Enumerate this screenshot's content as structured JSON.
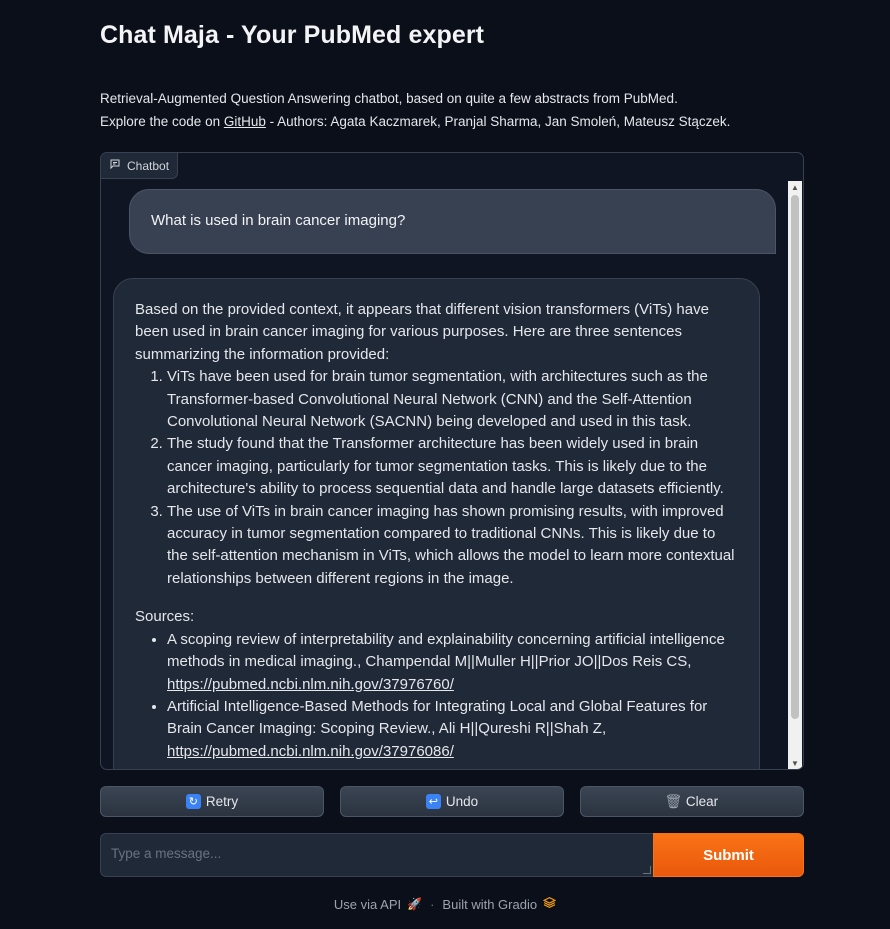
{
  "header": {
    "title": "Chat Maja - Your PubMed expert",
    "desc_line1": "Retrieval-Augmented Question Answering chatbot, based on quite a few abstracts from PubMed.",
    "desc_line2_prefix": "Explore the code on ",
    "github_link": "GitHub",
    "desc_line2_suffix": " - Authors: Agata Kaczmarek, Pranjal Sharma, Jan Smoleń, Mateusz Stączek."
  },
  "chatbot": {
    "label": "Chatbot",
    "user_message": "What is used in brain cancer imaging?",
    "bot": {
      "intro": "Based on the provided context, it appears that different vision transformers (ViTs) have been used in brain cancer imaging for various purposes. Here are three sentences summarizing the information provided:",
      "points": [
        "ViTs have been used for brain tumor segmentation, with architectures such as the Transformer-based Convolutional Neural Network (CNN) and the Self-Attention Convolutional Neural Network (SACNN) being developed and used in this task.",
        "The study found that the Transformer architecture has been widely used in brain cancer imaging, particularly for tumor segmentation tasks. This is likely due to the architecture's ability to process sequential data and handle large datasets efficiently.",
        "The use of ViTs in brain cancer imaging has shown promising results, with improved accuracy in tumor segmentation compared to traditional CNNs. This is likely due to the self-attention mechanism in ViTs, which allows the model to learn more contextual relationships between different regions in the image."
      ],
      "sources_title": "Sources:",
      "sources": [
        {
          "text": "A scoping review of interpretability and explainability concerning artificial intelligence methods in medical imaging., Champendal M||Muller H||Prior JO||Dos Reis CS, ",
          "url": "https://pubmed.ncbi.nlm.nih.gov/37976760/"
        },
        {
          "text": "Artificial Intelligence-Based Methods for Integrating Local and Global Features for Brain Cancer Imaging: Scoping Review., Ali H||Qureshi R||Shah Z, ",
          "url": "https://pubmed.ncbi.nlm.nih.gov/37976086/"
        }
      ]
    }
  },
  "buttons": {
    "retry": "Retry",
    "retry_icon": "↻",
    "undo": "Undo",
    "undo_icon": "↩",
    "clear": "Clear",
    "clear_icon": "🗑"
  },
  "input": {
    "placeholder": "Type a message...",
    "submit": "Submit"
  },
  "footer": {
    "api": "Use via API",
    "separator": "·",
    "built": "Built with Gradio"
  },
  "colors": {
    "background": "#0b0f19",
    "accent": "#f97316",
    "panel": "#1f2937"
  }
}
